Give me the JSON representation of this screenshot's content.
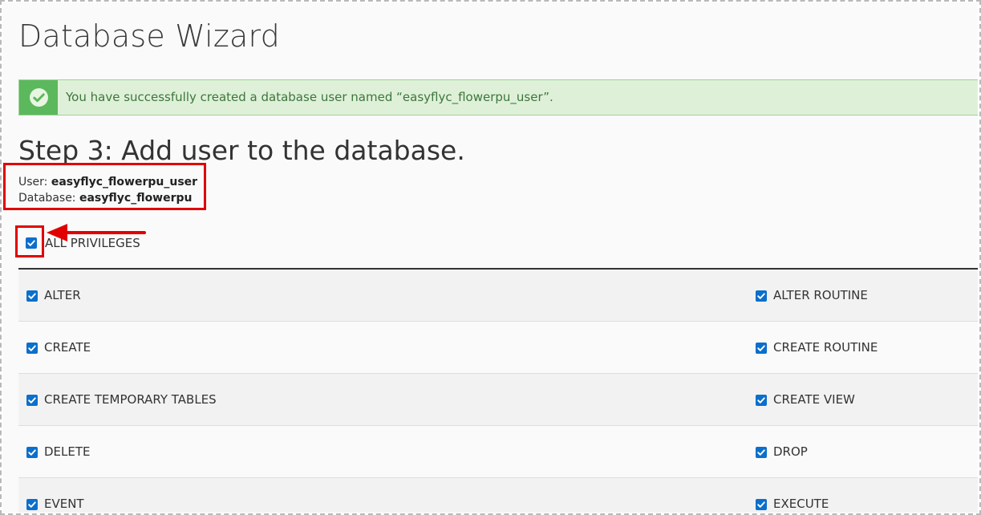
{
  "page": {
    "title": "Database Wizard"
  },
  "alert": {
    "icon": "check-circle-icon",
    "message": "You have successfully created a database user named “easyflyc_flowerpu_user”."
  },
  "step": {
    "title": "Step 3: Add user to the database.",
    "user_label": "User:",
    "user_value": "easyflyc_flowerpu_user",
    "database_label": "Database:",
    "database_value": "easyflyc_flowerpu"
  },
  "all_privileges": {
    "label": "ALL PRIVILEGES",
    "checked": true
  },
  "privileges": {
    "rows": [
      {
        "left": "ALTER",
        "right": "ALTER ROUTINE"
      },
      {
        "left": "CREATE",
        "right": "CREATE ROUTINE"
      },
      {
        "left": "CREATE TEMPORARY TABLES",
        "right": "CREATE VIEW"
      },
      {
        "left": "DELETE",
        "right": "DROP"
      },
      {
        "left": "EVENT",
        "right": "EXECUTE"
      }
    ]
  },
  "colors": {
    "checkbox": "#0b6fcc",
    "alert_bg": "#dff0d8",
    "alert_icon_bg": "#5cb85c",
    "alert_text": "#3c763d",
    "annotation_red": "#e10000"
  }
}
